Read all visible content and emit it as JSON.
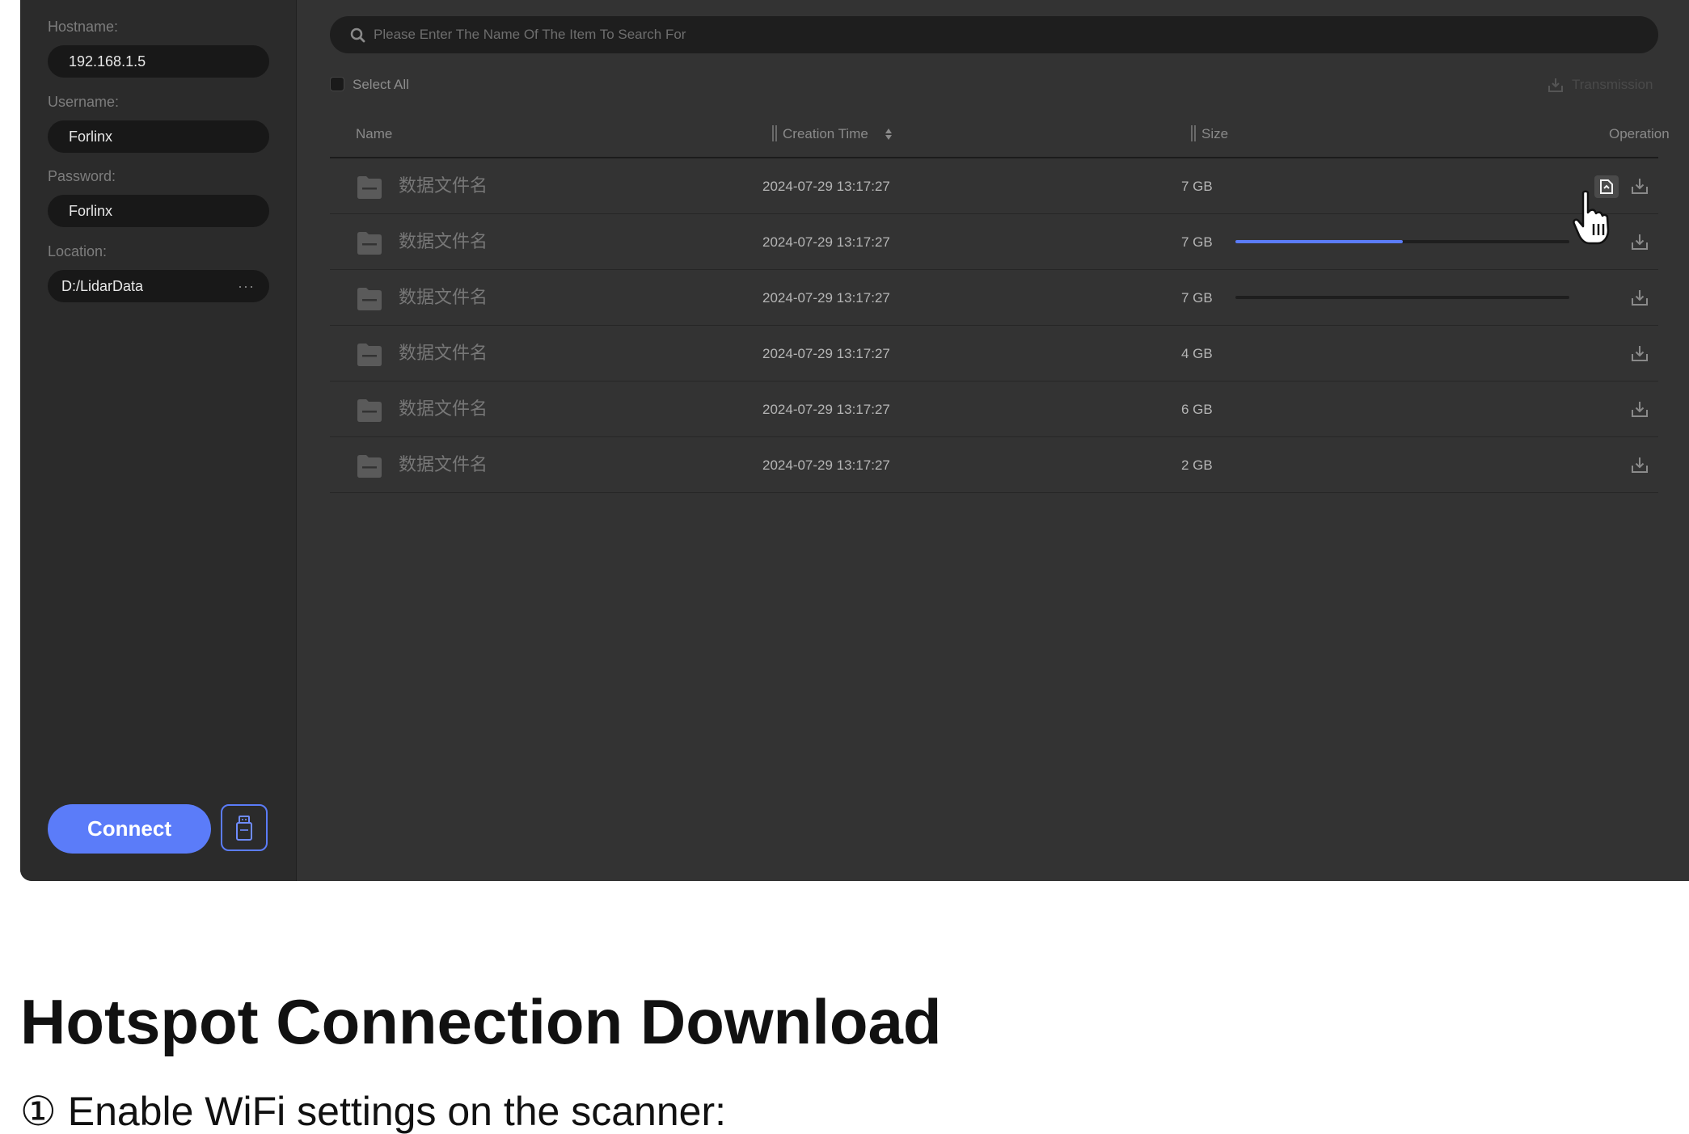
{
  "sidebar": {
    "hostname": {
      "label": "Hostname:",
      "value": "192.168.1.5"
    },
    "username": {
      "label": "Username:",
      "value": "Forlinx"
    },
    "password": {
      "label": "Password:",
      "value": "Forlinx"
    },
    "location": {
      "label": "Location:",
      "value": "D:/LidarData",
      "more": "···"
    },
    "connect_label": "Connect",
    "usb_icon": "usb-drive-icon"
  },
  "main": {
    "search": {
      "placeholder": "Please Enter The Name Of The Item To Search For",
      "icon": "search-icon"
    },
    "select_all_label": "Select All",
    "transmission_label": "Transmission",
    "columns": {
      "name": "Name",
      "creation_time": "Creation Time",
      "size": "Size",
      "operation": "Operation"
    },
    "rows": [
      {
        "name": "数据文件名",
        "time": "2024-07-29 13:17:27",
        "size": "7 GB",
        "progress": null
      },
      {
        "name": "数据文件名",
        "time": "2024-07-29 13:17:27",
        "size": "7 GB",
        "progress": 0.5
      },
      {
        "name": "数据文件名",
        "time": "2024-07-29 13:17:27",
        "size": "7 GB",
        "progress": 0
      },
      {
        "name": "数据文件名",
        "time": "2024-07-29 13:17:27",
        "size": "4 GB",
        "progress": null
      },
      {
        "name": "数据文件名",
        "time": "2024-07-29 13:17:27",
        "size": "6 GB",
        "progress": null
      },
      {
        "name": "数据文件名",
        "time": "2024-07-29 13:17:27",
        "size": "2 GB",
        "progress": null
      }
    ]
  },
  "doc": {
    "heading": "Hotspot Connection Download",
    "step": "① Enable WiFi settings on the scanner:"
  },
  "colors": {
    "accent": "#5b7cf9",
    "panel": "#333333",
    "sidebar": "#2b2b2b"
  }
}
